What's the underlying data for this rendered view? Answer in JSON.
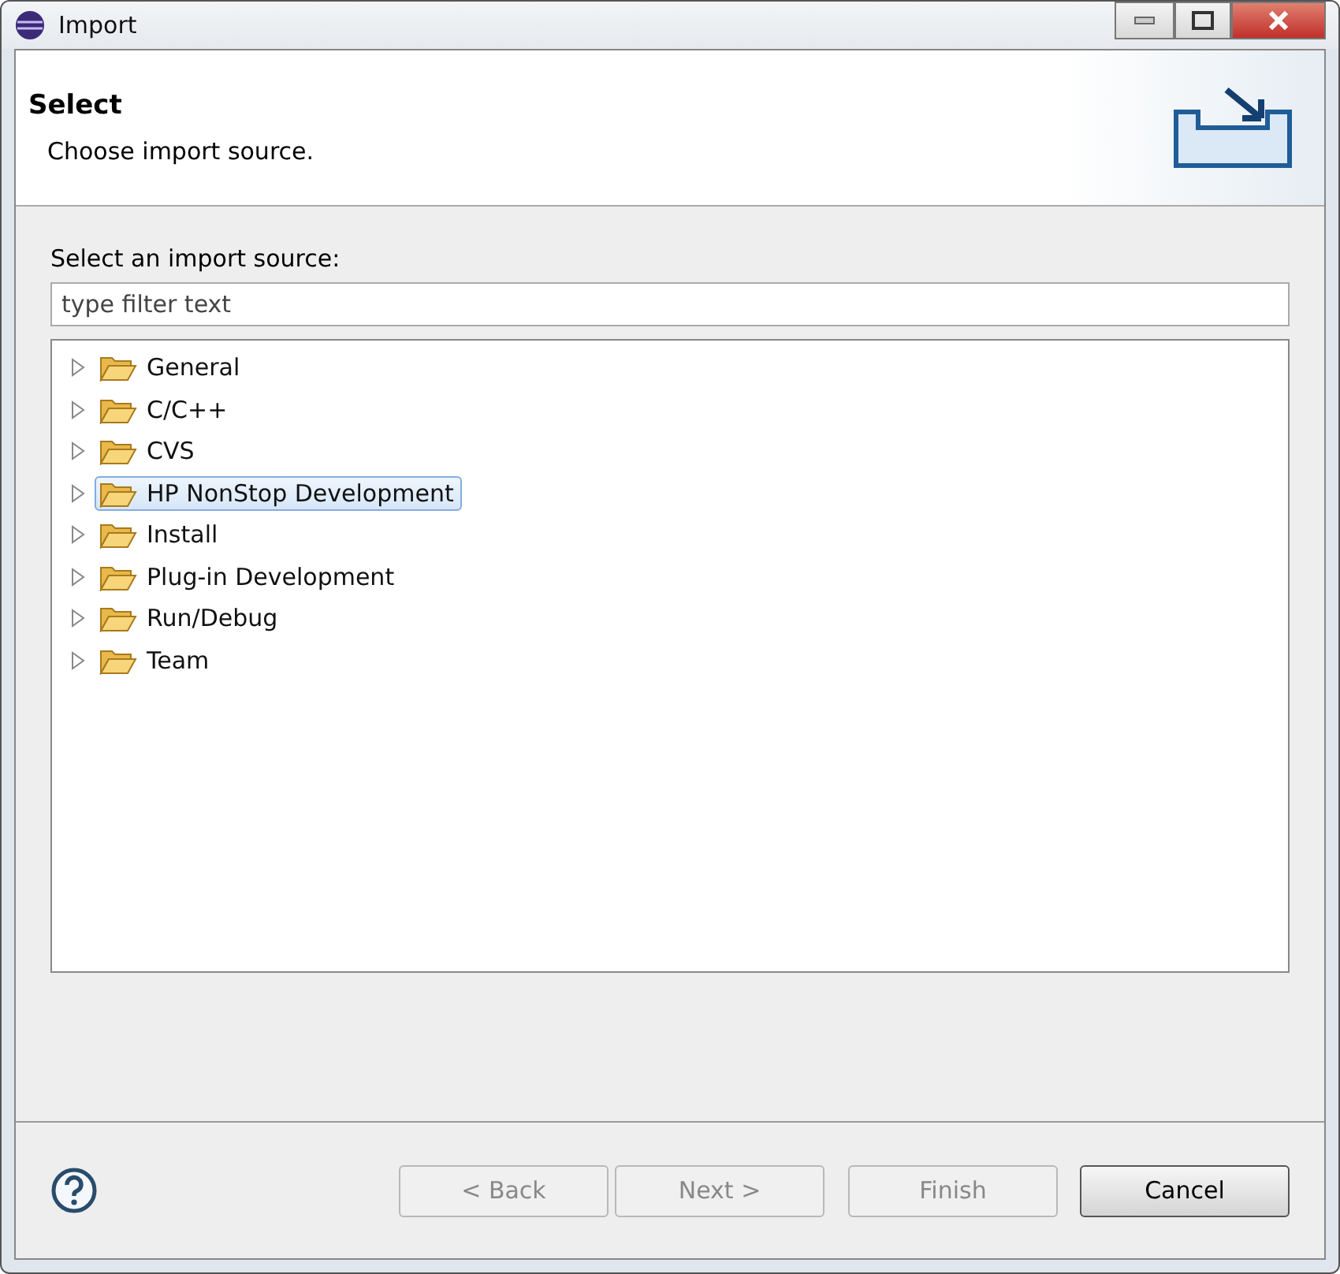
{
  "window": {
    "title": "Import"
  },
  "header": {
    "title": "Select",
    "description": "Choose import source."
  },
  "source_label": "Select an import source:",
  "filter": {
    "placeholder": "type filter text"
  },
  "tree": [
    {
      "label": "General",
      "selected": false
    },
    {
      "label": "C/C++",
      "selected": false
    },
    {
      "label": "CVS",
      "selected": false
    },
    {
      "label": "HP NonStop Development",
      "selected": true
    },
    {
      "label": "Install",
      "selected": false
    },
    {
      "label": "Plug-in Development",
      "selected": false
    },
    {
      "label": "Run/Debug",
      "selected": false
    },
    {
      "label": "Team",
      "selected": false
    }
  ],
  "buttons": [
    {
      "label": "< Back",
      "disabled": true
    },
    {
      "label": "Next >",
      "disabled": true
    },
    {
      "label": "Finish",
      "disabled": true
    },
    {
      "label": "Cancel",
      "disabled": false
    }
  ]
}
